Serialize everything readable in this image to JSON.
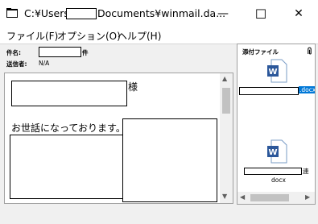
{
  "window": {
    "title_prefix": "C:¥Users¥",
    "title_suffix": "Documents¥winmail.da...",
    "minimize_glyph": "—",
    "maximize_glyph": "☐",
    "close_glyph": "✕"
  },
  "menu": {
    "items": [
      {
        "label": "ファイル(F)"
      },
      {
        "label": "オプション(O)"
      },
      {
        "label": "ヘルプ(H)"
      }
    ]
  },
  "header": {
    "subject_label": "件名:",
    "subject_suffix": "件",
    "sender_label": "送信者:",
    "sender_value": "N/A"
  },
  "body": {
    "salutation_suffix": "様",
    "greeting": "お世話になっております。",
    "scroll_up": "▲",
    "scroll_down": "▼"
  },
  "attachments": {
    "label": "添付ファイル",
    "files": [
      {
        "name_suffix": ".docx",
        "icon": "word-doc-icon"
      },
      {
        "name_suffix": "連",
        "name_line2": "docx",
        "icon": "word-doc-icon"
      }
    ],
    "scroll_left": "◀",
    "scroll_right": "▶"
  },
  "colors": {
    "word_blue": "#2b579a",
    "selection": "#0078d7"
  }
}
